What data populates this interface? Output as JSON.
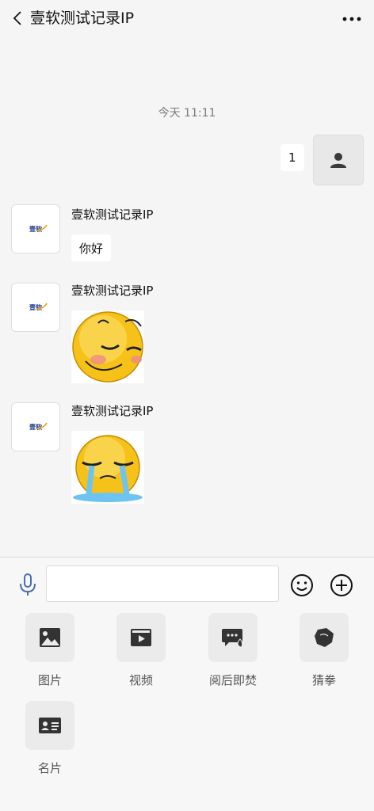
{
  "header": {
    "title": "壹软测试记录IP",
    "back_icon": "chevron-left-icon",
    "more_icon": "more-dots-icon"
  },
  "chat": {
    "timestamp": "今天 11:11",
    "self_message": {
      "text": "1",
      "avatar_icon": "user-icon"
    },
    "messages": [
      {
        "sender": "壹软测试记录IP",
        "type": "text",
        "text": "你好",
        "avatar_logo": "壹软"
      },
      {
        "sender": "壹软测试记录IP",
        "type": "sticker",
        "sticker": "smirk-emoji",
        "avatar_logo": "壹软"
      },
      {
        "sender": "壹软测试记录IP",
        "type": "sticker",
        "sticker": "crying-emoji",
        "avatar_logo": "壹软"
      }
    ]
  },
  "inputbar": {
    "value": "",
    "placeholder": "",
    "mic_icon": "microphone-icon",
    "emoji_icon": "smiley-icon",
    "plus_icon": "plus-circle-icon"
  },
  "tools": [
    {
      "label": "图片",
      "icon": "image-icon"
    },
    {
      "label": "视频",
      "icon": "video-icon"
    },
    {
      "label": "阅后即焚",
      "icon": "burn-message-icon"
    },
    {
      "label": "猜拳",
      "icon": "rock-paper-scissors-icon"
    },
    {
      "label": "名片",
      "icon": "contact-card-icon"
    }
  ]
}
